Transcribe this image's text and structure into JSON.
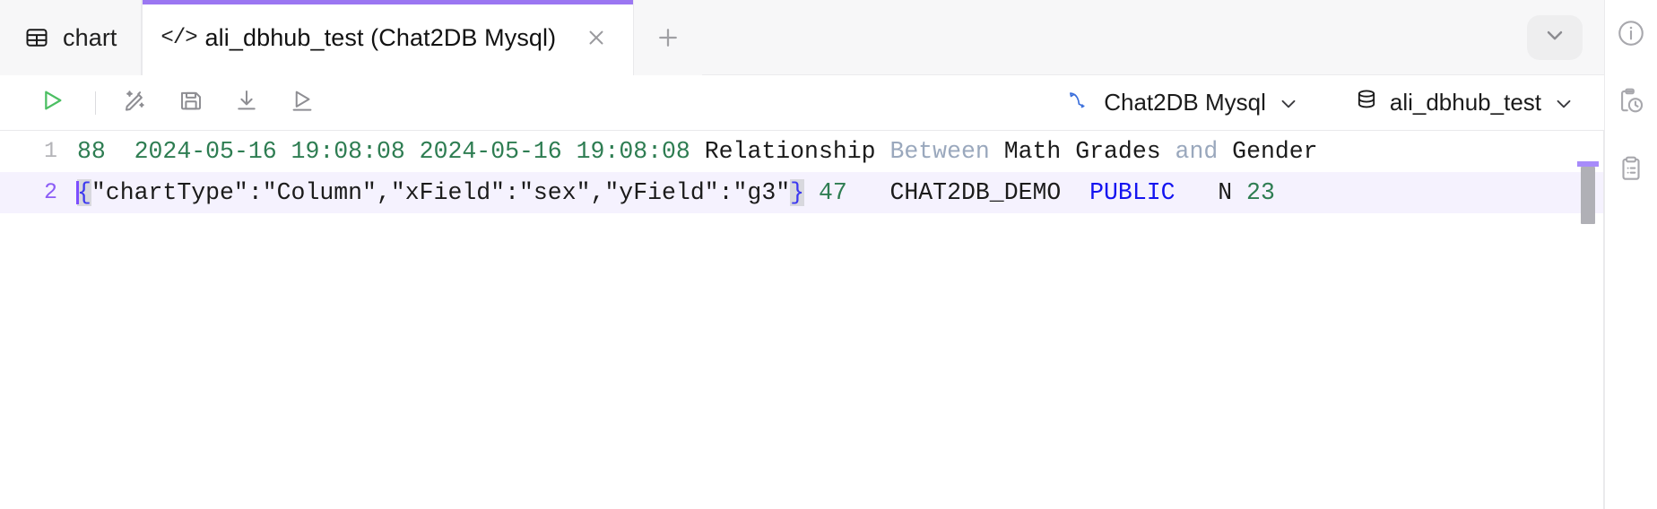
{
  "window": {
    "tabs": [
      {
        "label": "chart",
        "icon": "table-grid-icon",
        "active": false,
        "closable": false
      },
      {
        "label": "ali_dbhub_test (Chat2DB Mysql)",
        "icon": "code-tag-icon",
        "active": true,
        "closable": true
      }
    ],
    "new_tab_label": "+",
    "tab_overflow_icon": "chevron-down-icon",
    "accent_color": "#9b77f2"
  },
  "toolbar": {
    "buttons": [
      {
        "name": "run-sql-button",
        "icon": "play-triangle-icon",
        "color": "#4cbf63"
      },
      {
        "name": "format-sql-button",
        "icon": "magic-wand-pencil-icon",
        "color": "#8e8e93"
      },
      {
        "name": "save-button",
        "icon": "floppy-disk-icon",
        "color": "#8e8e93"
      },
      {
        "name": "download-button",
        "icon": "download-arrow-icon",
        "color": "#8e8e93"
      },
      {
        "name": "execute-selection-button",
        "icon": "play-underline-icon",
        "color": "#8e8e93"
      }
    ],
    "connection_select": {
      "label": "Chat2DB Mysql",
      "icon": "mysql-dolphin-icon",
      "icon_color": "#3b6fdb",
      "chevron": "chevron-down-icon"
    },
    "database_select": {
      "label": "ali_dbhub_test",
      "icon": "database-cylinder-icon",
      "chevron": "chevron-down-icon"
    }
  },
  "editor": {
    "lines": [
      {
        "number": "1",
        "active": false,
        "tokens": [
          {
            "text": "88  ",
            "type": "num"
          },
          {
            "text": "2024-05-16 19:08:08 2024-05-16 19:08:08 ",
            "type": "num"
          },
          {
            "text": "Relationship ",
            "type": "plain"
          },
          {
            "text": "Between ",
            "type": "kw"
          },
          {
            "text": "Math Grades ",
            "type": "plain"
          },
          {
            "text": "and ",
            "type": "kw"
          },
          {
            "text": "Gender",
            "type": "plain"
          }
        ]
      },
      {
        "number": "2",
        "active": true,
        "tokens": [
          {
            "text": "{",
            "type": "brace-open"
          },
          {
            "text": "\"chartType\":\"Column\",\"xField\":\"sex\",\"yField\":\"g3\"",
            "type": "plain"
          },
          {
            "text": "}",
            "type": "brace-close"
          },
          {
            "text": " 47   ",
            "type": "num"
          },
          {
            "text": "CHAT2DB_DEMO  ",
            "type": "plain"
          },
          {
            "text": "PUBLIC",
            "type": "blue"
          },
          {
            "text": "   N ",
            "type": "plain"
          },
          {
            "text": "23",
            "type": "num"
          }
        ]
      }
    ],
    "scrollbar": {
      "name": "vertical-scrollbar",
      "visible": true
    }
  },
  "right_rail": {
    "items": [
      {
        "name": "info-icon",
        "tooltip": "info"
      },
      {
        "name": "history-clipboard-icon",
        "tooltip": "history"
      },
      {
        "name": "saved-list-clipboard-icon",
        "tooltip": "saved"
      }
    ]
  }
}
